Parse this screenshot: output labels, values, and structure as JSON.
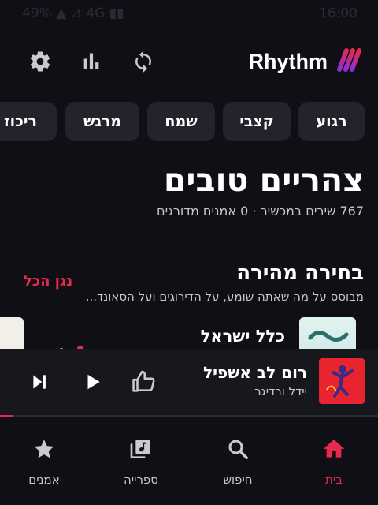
{
  "status_bar": {
    "left_text": "49% ▲ ⊿ 4G ▮▮",
    "time": "16:00"
  },
  "app": {
    "brand": "Rhythm",
    "accent_color": "#e8294f"
  },
  "topbar": {
    "icons": [
      "refresh-icon",
      "bar-chart-icon",
      "gear-icon"
    ]
  },
  "chips": [
    "רגוע",
    "קצבי",
    "שמח",
    "מרגש",
    "ריכוז"
  ],
  "home": {
    "greeting": "צהריים טובים",
    "stats": "767 שירים במכשיר · 0 אמנים מדורגים"
  },
  "quick_pick": {
    "title": "בחירה מהירה",
    "subtitle": "מבוסס על מה שאתה שומע, על הדירוגים ועל הסאונד...",
    "play_all": "נגן הכל",
    "first_item_title": "כלל ישראל"
  },
  "now_playing": {
    "title": "רום לב אשפיל",
    "artist": "יידל ורדיגר",
    "progress": 0.035
  },
  "bottom_nav": {
    "items": [
      {
        "label": "בית",
        "icon": "home-icon",
        "active": true
      },
      {
        "label": "חיפוש",
        "icon": "search-icon",
        "active": false
      },
      {
        "label": "ספרייה",
        "icon": "library-icon",
        "active": false
      },
      {
        "label": "אמנים",
        "icon": "star-icon",
        "active": false
      }
    ]
  }
}
